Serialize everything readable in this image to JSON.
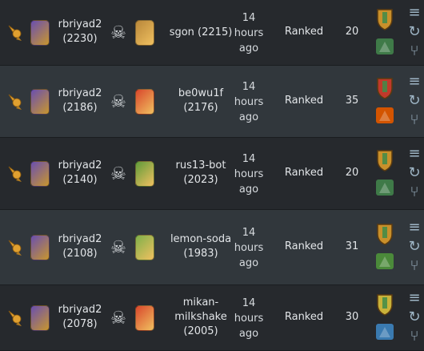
{
  "battles": [
    {
      "player": "rbriyad2",
      "player_rating": "(2230)",
      "opponent": "sgon (2215)",
      "opponent_rating": "",
      "time": [
        "14",
        "hours",
        "ago"
      ],
      "mode": "Ranked",
      "mana": "20",
      "result_icon": "skull-icon",
      "opponent_color": "#b8873a",
      "card_colors": [
        "#c9902b",
        "#3f7a48"
      ]
    },
    {
      "player": "rbriyad2",
      "player_rating": "(2186)",
      "opponent": "be0wu1f",
      "opponent_rating": "(2176)",
      "time": [
        "14",
        "hours",
        "ago"
      ],
      "mode": "Ranked",
      "mana": "35",
      "result_icon": "skull-icon",
      "opponent_color": "#d9472c",
      "card_colors": [
        "#c0392b",
        "#d35400"
      ]
    },
    {
      "player": "rbriyad2",
      "player_rating": "(2140)",
      "opponent": "rus13-bot",
      "opponent_rating": "(2023)",
      "time": [
        "14",
        "hours",
        "ago"
      ],
      "mode": "Ranked",
      "mana": "20",
      "result_icon": "skull-icon",
      "opponent_color": "#5f9b3a",
      "card_colors": [
        "#c9902b",
        "#3f7a48"
      ]
    },
    {
      "player": "rbriyad2",
      "player_rating": "(2108)",
      "opponent": "lemon-soda",
      "opponent_rating": "(1983)",
      "time": [
        "14",
        "hours",
        "ago"
      ],
      "mode": "Ranked",
      "mana": "31",
      "result_icon": "skull-icon",
      "opponent_color": "#7fb04a",
      "card_colors": [
        "#c9902b",
        "#4b8a3a"
      ]
    },
    {
      "player": "rbriyad2",
      "player_rating": "(2078)",
      "opponent": "mikan-",
      "opponent_line2": "milkshake",
      "opponent_rating": "(2005)",
      "time": [
        "14",
        "hours",
        "ago"
      ],
      "mode": "Ranked",
      "mana": "30",
      "result_icon": "skull-icon",
      "opponent_color": "#d9472c",
      "card_colors": [
        "#c9b23a",
        "#3a7ab0"
      ]
    }
  ],
  "player_avatar_color": "#6a4fb0",
  "trophy_color": "#e0a030",
  "row_bg": [
    "#26292d",
    "#31373c"
  ]
}
